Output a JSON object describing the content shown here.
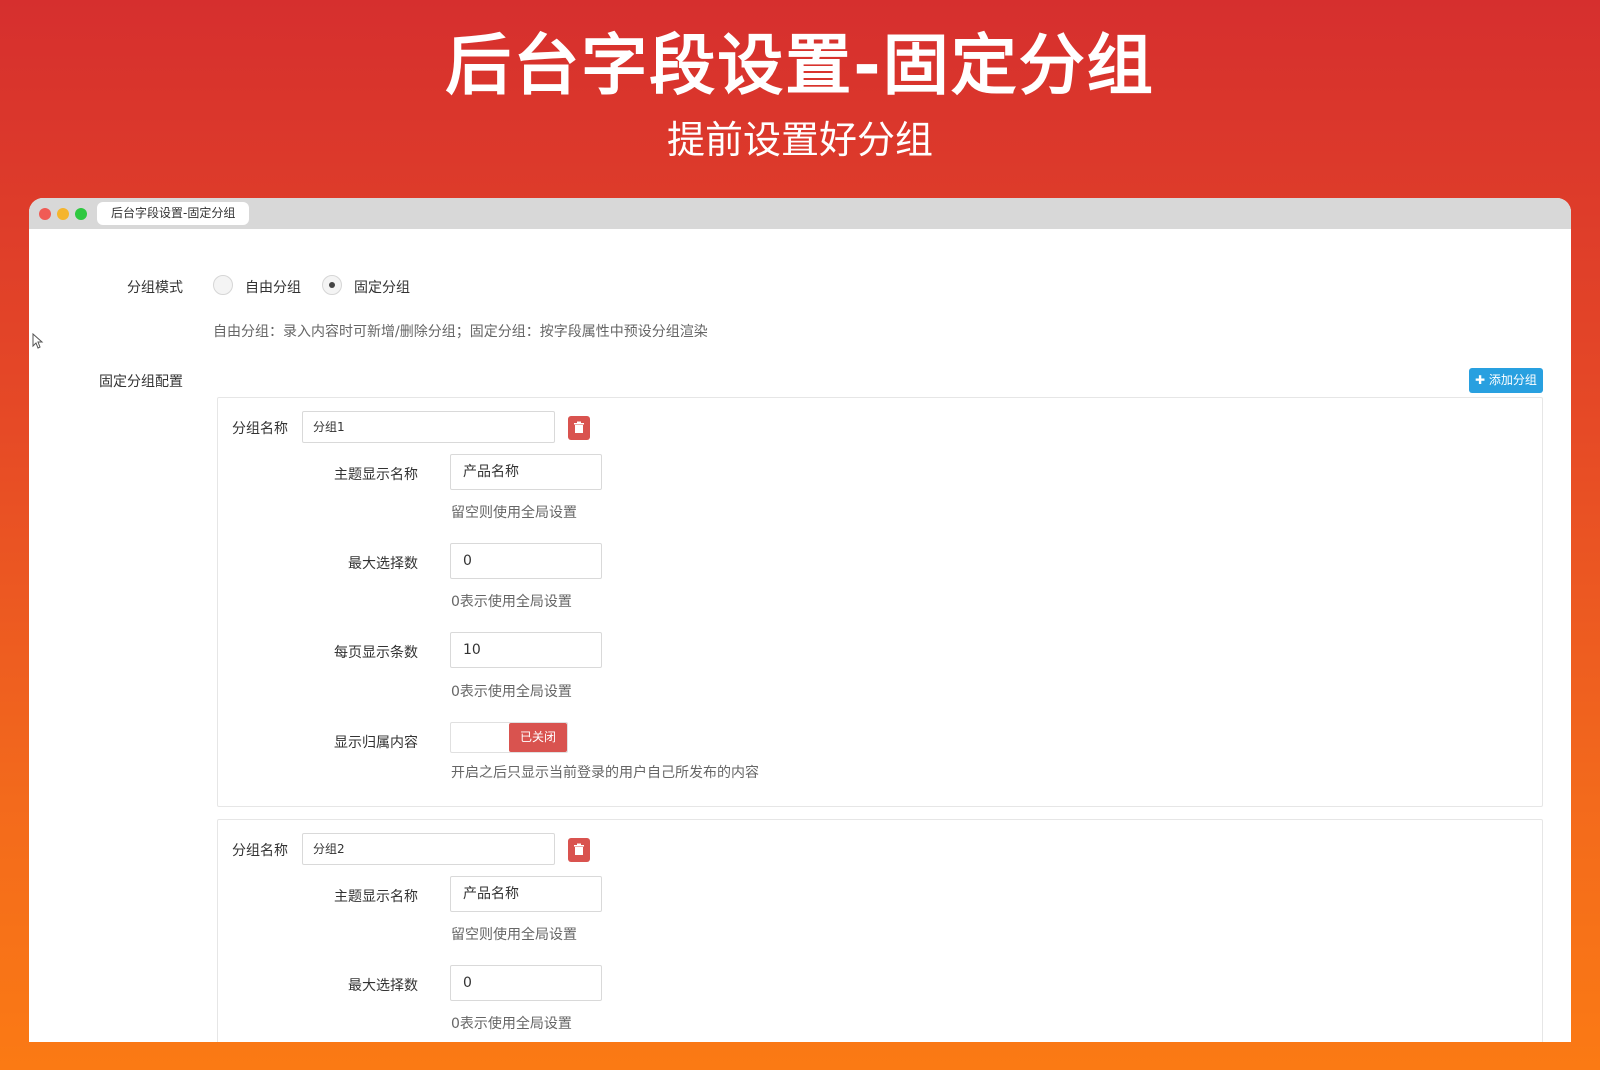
{
  "hero": {
    "title": "后台字段设置-固定分组",
    "subtitle": "提前设置好分组"
  },
  "window": {
    "tab_title": "后台字段设置-固定分组"
  },
  "form": {
    "mode_label": "分组模式",
    "mode_options": [
      {
        "label": "自由分组",
        "checked": false
      },
      {
        "label": "固定分组",
        "checked": true
      }
    ],
    "mode_help": "自由分组：录入内容时可新增/删除分组；固定分组：按字段属性中预设分组渲染",
    "config_label": "固定分组配置",
    "add_button": "添加分组",
    "groups": [
      {
        "name_label": "分组名称",
        "name_value": "分组1",
        "title_label": "主题显示名称",
        "title_value": "产品名称",
        "title_help": "留空则使用全局设置",
        "max_label": "最大选择数",
        "max_value": "0",
        "max_help": "0表示使用全局设置",
        "per_page_label": "每页显示条数",
        "per_page_value": "10",
        "per_page_help": "0表示使用全局设置",
        "owner_label": "显示归属内容",
        "owner_toggle": "已关闭",
        "owner_help": "开启之后只显示当前登录的用户自己所发布的内容"
      },
      {
        "name_label": "分组名称",
        "name_value": "分组2",
        "title_label": "主题显示名称",
        "title_value": "产品名称",
        "title_help": "留空则使用全局设置",
        "max_label": "最大选择数",
        "max_value": "0",
        "max_help": "0表示使用全局设置"
      }
    ]
  },
  "colors": {
    "accent_blue": "#28a0e0",
    "danger_red": "#d9534f",
    "gradient_top": "#d62f2e",
    "gradient_bottom": "#fb7a14"
  }
}
